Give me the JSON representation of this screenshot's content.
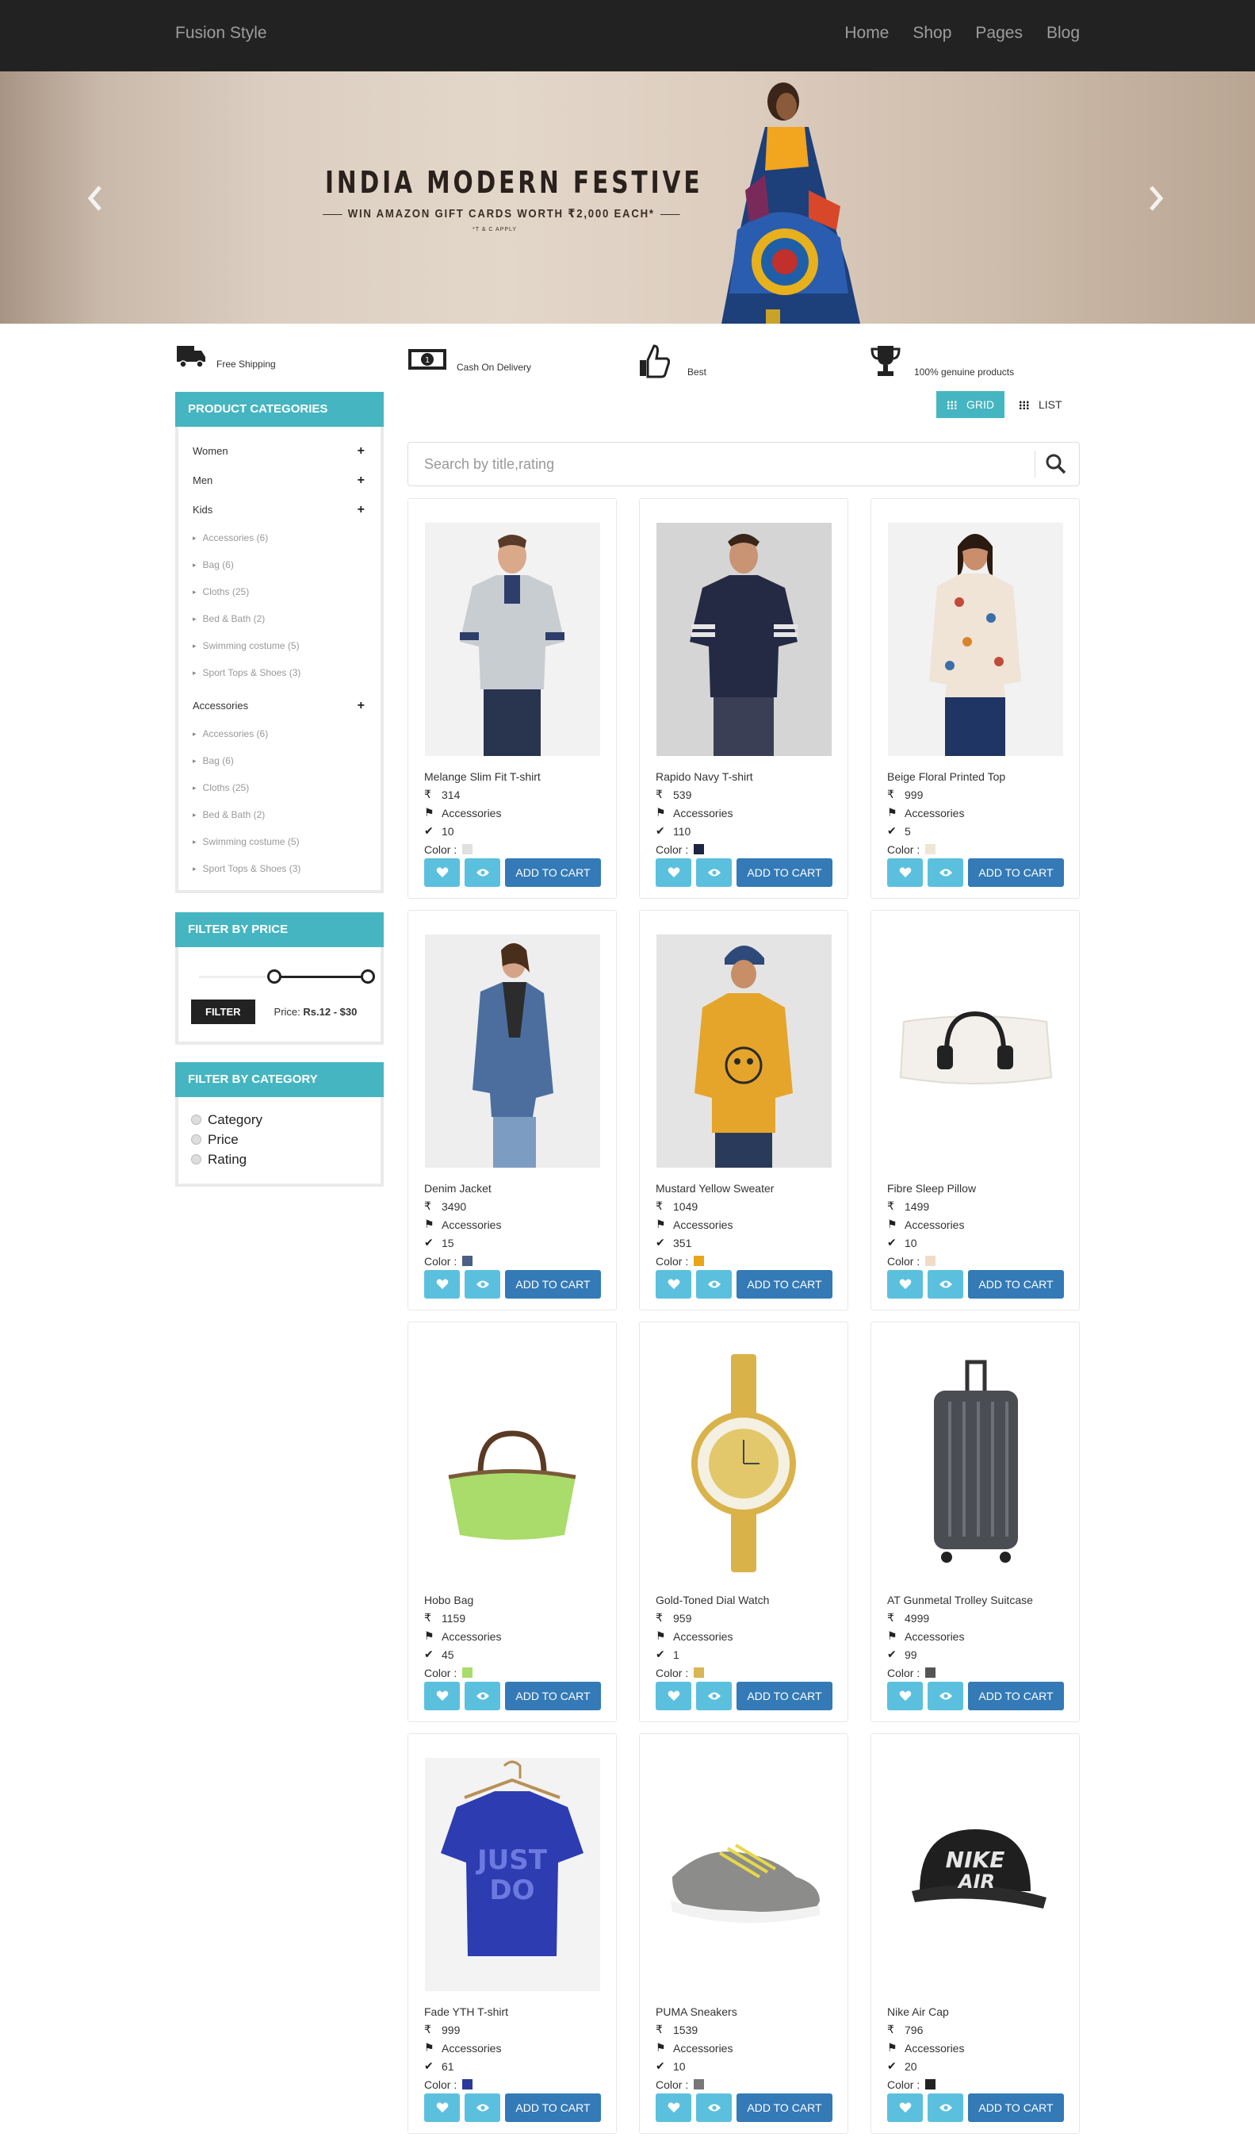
{
  "navbar": {
    "brand": "Fusion Style",
    "links": [
      "Home",
      "Shop",
      "Pages",
      "Blog"
    ]
  },
  "banner": {
    "title": "INDIA MODERN FESTIVE",
    "subtitle": "WIN AMAZON GIFT CARDS WORTH ₹2,000 EACH*",
    "tc": "*T & C APPLY",
    "prev_icon": "chevron-left-icon",
    "next_icon": "chevron-right-icon"
  },
  "features": [
    {
      "label": "Free Shipping",
      "icon": "truck-icon"
    },
    {
      "label": "Cash On Delivery",
      "icon": "money-icon"
    },
    {
      "label": "Best",
      "icon": "thumbs-up-icon"
    },
    {
      "label": "100% genuine products",
      "icon": "trophy-icon"
    }
  ],
  "sidebar": {
    "categories_title": "PRODUCT CATEGORIES",
    "categories": [
      {
        "label": "Women",
        "sub": []
      },
      {
        "label": "Men",
        "sub": []
      },
      {
        "label": "Kids",
        "sub": [
          "Accessories (6)",
          "Bag (6)",
          "Cloths (25)",
          "Bed & Bath (2)",
          "Swimming costume (5)",
          "Sport Tops & Shoes (3)"
        ]
      },
      {
        "label": "Accessories",
        "sub": [
          "Accessories (6)",
          "Bag (6)",
          "Cloths (25)",
          "Bed & Bath (2)",
          "Swimming costume (5)",
          "Sport Tops & Shoes (3)"
        ]
      }
    ],
    "price_title": "FILTER BY PRICE",
    "filter_label": "FILTER",
    "price_prefix": "Price:",
    "price_range": "Rs.12 - $30",
    "category_title": "FILTER BY CATEGORY",
    "filter_options": [
      "Category",
      "Price",
      "Rating"
    ]
  },
  "view": {
    "grid_label": "GRID",
    "list_label": "LIST",
    "active": "grid"
  },
  "search": {
    "placeholder": "Search by title,rating",
    "value": ""
  },
  "currency_symbol": "₹",
  "cart_label": "ADD TO CART",
  "color_label": "Color :",
  "products": [
    {
      "name": "Melange Slim Fit T-shirt",
      "price": "314",
      "category": "Accessories",
      "stock": "10",
      "color": "#e0e0e0"
    },
    {
      "name": "Rapido Navy T-shirt",
      "price": "539",
      "category": "Accessories",
      "stock": "110",
      "color": "#1f2440"
    },
    {
      "name": "Beige Floral Printed Top",
      "price": "999",
      "category": "Accessories",
      "stock": "5",
      "color": "#efe6d6"
    },
    {
      "name": "Denim Jacket",
      "price": "3490",
      "category": "Accessories",
      "stock": "15",
      "color": "#4a5f86"
    },
    {
      "name": "Mustard Yellow Sweater",
      "price": "1049",
      "category": "Accessories",
      "stock": "351",
      "color": "#e9a519"
    },
    {
      "name": "Fibre Sleep Pillow",
      "price": "1499",
      "category": "Accessories",
      "stock": "10",
      "color": "#f1dcc8"
    },
    {
      "name": "Hobo Bag",
      "price": "1159",
      "category": "Accessories",
      "stock": "45",
      "color": "#a9dc6a"
    },
    {
      "name": "Gold-Toned Dial Watch",
      "price": "959",
      "category": "Accessories",
      "stock": "1",
      "color": "#d8b655"
    },
    {
      "name": "AT Gunmetal Trolley Suitcase",
      "price": "4999",
      "category": "Accessories",
      "stock": "99",
      "color": "#555555"
    },
    {
      "name": "Fade YTH T-shirt",
      "price": "999",
      "category": "Accessories",
      "stock": "61",
      "color": "#2b3a9a"
    },
    {
      "name": "PUMA Sneakers",
      "price": "1539",
      "category": "Accessories",
      "stock": "10",
      "color": "#777777"
    },
    {
      "name": "Nike Air Cap",
      "price": "796",
      "category": "Accessories",
      "stock": "20",
      "color": "#222222"
    }
  ]
}
